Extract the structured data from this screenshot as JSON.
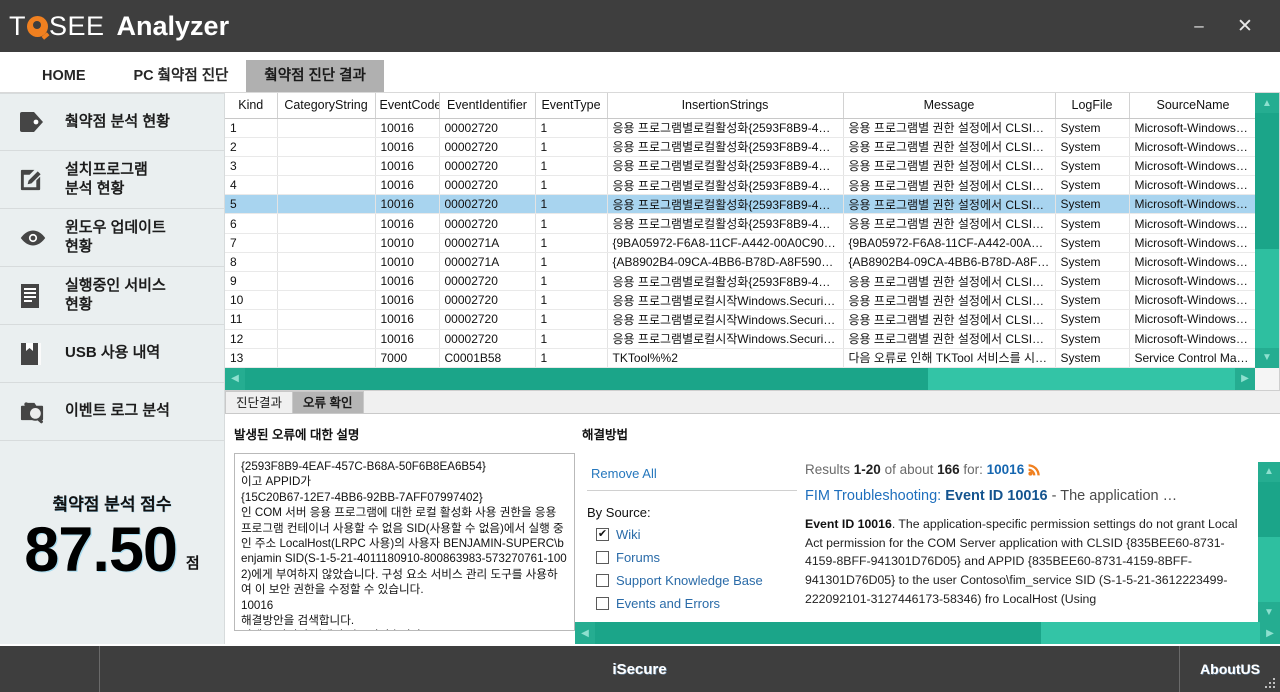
{
  "window": {
    "logo_part1": "T",
    "logo_part2": "SEE",
    "logo_part3": "Analyzer",
    "minimize_label": "–",
    "close_label": "✕"
  },
  "top_tabs": [
    {
      "label": "HOME",
      "active": false
    },
    {
      "label": "PC 췈약점 진단",
      "active": false
    },
    {
      "label": "췈약점 진단 결과",
      "active": true
    }
  ],
  "sidebar": {
    "items": [
      {
        "label": "췈약점 분석 현황",
        "icon": "tag-icon"
      },
      {
        "label": "설치프로그램\n분석 현황",
        "icon": "edit-square-icon"
      },
      {
        "label": "윈도우 업데이트\n현황",
        "icon": "eye-icon"
      },
      {
        "label": "실행중인 서비스\n현황",
        "icon": "document-lines-icon"
      },
      {
        "label": "USB 사용 내역",
        "icon": "book-icon"
      },
      {
        "label": "이벤트 로그 분석",
        "icon": "camera-search-icon"
      }
    ],
    "score_title": "췈약점 분석 점수",
    "score_value": "87.50",
    "score_unit": "점"
  },
  "table": {
    "columns": [
      "Kind",
      "CategoryString",
      "EventCode",
      "EventIdentifier",
      "EventType",
      "InsertionStrings",
      "Message",
      "LogFile",
      "SourceName"
    ],
    "rows": [
      {
        "kind": "1",
        "category": "",
        "code": "10016",
        "eid": "00002720",
        "etype": "1",
        "ins": "응용 프로그램별로컬활성화{2593F8B9-4…",
        "msg": "응용 프로그램별 권한 설정에서 CLSID가 {…",
        "log": "System",
        "src": "Microsoft-Windows-D…",
        "selected": false
      },
      {
        "kind": "2",
        "category": "",
        "code": "10016",
        "eid": "00002720",
        "etype": "1",
        "ins": "응용 프로그램별로컬활성화{2593F8B9-4…",
        "msg": "응용 프로그램별 권한 설정에서 CLSID가 {…",
        "log": "System",
        "src": "Microsoft-Windows-D…",
        "selected": false
      },
      {
        "kind": "3",
        "category": "",
        "code": "10016",
        "eid": "00002720",
        "etype": "1",
        "ins": "응용 프로그램별로컬활성화{2593F8B9-4…",
        "msg": "응용 프로그램별 권한 설정에서 CLSID가 {…",
        "log": "System",
        "src": "Microsoft-Windows-D…",
        "selected": false
      },
      {
        "kind": "4",
        "category": "",
        "code": "10016",
        "eid": "00002720",
        "etype": "1",
        "ins": "응용 프로그램별로컬활성화{2593F8B9-4…",
        "msg": "응용 프로그램별 권한 설정에서 CLSID가 {…",
        "log": "System",
        "src": "Microsoft-Windows-D…",
        "selected": false
      },
      {
        "kind": "5",
        "category": "",
        "code": "10016",
        "eid": "00002720",
        "etype": "1",
        "ins": "응용 프로그램별로컬활성화{2593F8B9-4…",
        "msg": "응용 프로그램별 권한 설정에서 CLSID가 {…",
        "log": "System",
        "src": "Microsoft-Windows-D…",
        "selected": true
      },
      {
        "kind": "6",
        "category": "",
        "code": "10016",
        "eid": "00002720",
        "etype": "1",
        "ins": "응용 프로그램별로컬활성화{2593F8B9-4…",
        "msg": "응용 프로그램별 권한 설정에서 CLSID가 {…",
        "log": "System",
        "src": "Microsoft-Windows-D…",
        "selected": false
      },
      {
        "kind": "7",
        "category": "",
        "code": "10010",
        "eid": "0000271A",
        "etype": "1",
        "ins": "{9BA05972-F6A8-11CF-A442-00A0C90A8…",
        "msg": "{9BA05972-F6A8-11CF-A442-00A0C90A8…",
        "log": "System",
        "src": "Microsoft-Windows-D…",
        "selected": false
      },
      {
        "kind": "8",
        "category": "",
        "code": "10010",
        "eid": "0000271A",
        "etype": "1",
        "ins": "{AB8902B4-09CA-4BB6-B78D-A8F59079A…",
        "msg": "{AB8902B4-09CA-4BB6-B78D-A8F59079A…",
        "log": "System",
        "src": "Microsoft-Windows-D…",
        "selected": false
      },
      {
        "kind": "9",
        "category": "",
        "code": "10016",
        "eid": "00002720",
        "etype": "1",
        "ins": "응용 프로그램별로컬활성화{2593F8B9-4…",
        "msg": "응용 프로그램별 권한 설정에서 CLSID가 {…",
        "log": "System",
        "src": "Microsoft-Windows-D…",
        "selected": false
      },
      {
        "kind": "10",
        "category": "",
        "code": "10016",
        "eid": "00002720",
        "etype": "1",
        "ins": "응용 프로그램별로컬시작Windows.Securi…",
        "msg": "응용 프로그램별 권한 설정에서 CLSID가 …",
        "log": "System",
        "src": "Microsoft-Windows-D…",
        "selected": false
      },
      {
        "kind": "11",
        "category": "",
        "code": "10016",
        "eid": "00002720",
        "etype": "1",
        "ins": "응용 프로그램별로컬시작Windows.Securi…",
        "msg": "응용 프로그램별 권한 설정에서 CLSID가 …",
        "log": "System",
        "src": "Microsoft-Windows-D…",
        "selected": false
      },
      {
        "kind": "12",
        "category": "",
        "code": "10016",
        "eid": "00002720",
        "etype": "1",
        "ins": "응용 프로그램별로컬시작Windows.Securi…",
        "msg": "응용 프로그램별 권한 설정에서 CLSID가 …",
        "log": "System",
        "src": "Microsoft-Windows-D…",
        "selected": false
      },
      {
        "kind": "13",
        "category": "",
        "code": "7000",
        "eid": "C0001B58",
        "etype": "1",
        "ins": "TKTool%%2",
        "msg": "다음 오류로 인해 TKTool 서비스를 시작하…",
        "log": "System",
        "src": "Service Control Mana…",
        "selected": false
      }
    ]
  },
  "lower_tabs": [
    {
      "label": "진단결과",
      "active": false
    },
    {
      "label": "오류 확인",
      "active": true
    }
  ],
  "detail": {
    "left_title": "발생된 오류에 대한 설명",
    "error_text": "{2593F8B9-4EAF-457C-B68A-50F6B8EA6B54}\n이고 APPID가\n{15C20B67-12E7-4BB6-92BB-7AFF07997402}\n인 COM 서버 응용 프로그램에 대한 로컬 활성화 사용 권한을 응용 프로그램 컨테이너 사용할 수 없음 SID(사용할 수 없음)에서 실행 중인 주소 LocalHost(LRPC 사용)의 사용자 BENJAMIN-SUPERC\\benjamin SID(S-1-5-21-4011180910-800863983-573270761-1002)에게 부여하지 않았습니다. 구성 요소 서비스 관리 도구를 사용하여 이 보안 권한을 수정할 수 있습니다.\n10016\n해결방안을 검색합니다.\n이벤트 아이디 검색이 완료되었습니다."
  },
  "solution": {
    "title": "해결방법",
    "remove_all": "Remove All",
    "by_source_label": "By Source:",
    "sources": [
      {
        "label": "Wiki",
        "checked": true
      },
      {
        "label": "Forums",
        "checked": false
      },
      {
        "label": "Support Knowledge Base",
        "checked": false
      },
      {
        "label": "Events and Errors",
        "checked": false
      }
    ],
    "results": {
      "prefix": "Results ",
      "range": "1-20",
      "middle": " of about ",
      "total": "166",
      "for_label": " for: ",
      "query": "10016",
      "link_prefix": "FIM Troubleshooting: ",
      "link_bold": "Event ID 10016",
      "link_tail": " - The application …",
      "body_bold": "Event ID 10016",
      "body_text": ". The application-specific permission settings do not grant Local Act permission for the COM Server application with CLSID {835BEE60-8731-4159-8BFF-941301D76D05} and APPID {835BEE60-8731-4159-8BFF-941301D76D05} to the user Contoso\\fim_service SID (S-1-5-21-3612223499-222092101-3127446173-58346) fro LocalHost (Using"
    }
  },
  "footer": {
    "center": "iSecure",
    "right": "AboutUS"
  },
  "colors": {
    "titlebar": "#3e3e3e",
    "accent_orange": "#f08020",
    "scroll_teal": "#2ebfa0",
    "selection_blue": "#a8d4ef",
    "link_blue": "#1f6fbd"
  }
}
